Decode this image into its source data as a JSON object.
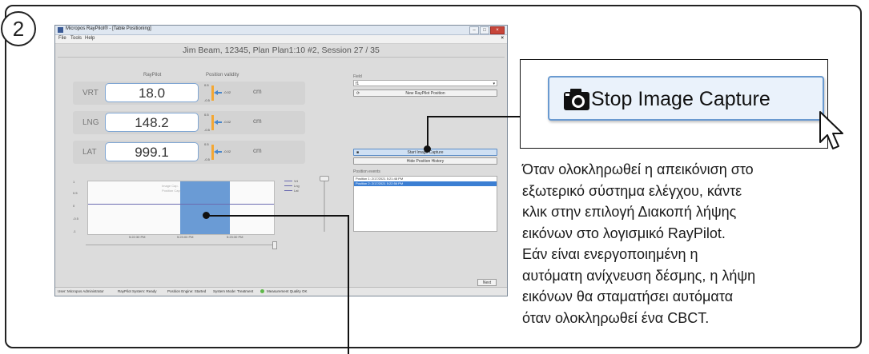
{
  "step_number": "2",
  "window": {
    "title": "Micropos RayPilot® - [Table Positioning]",
    "menu": [
      "File",
      "Tools",
      "Help"
    ],
    "menu_close": "×",
    "controls": {
      "minimize": "–",
      "maximize": "□",
      "close": "×"
    },
    "patient_info": "Jim Beam, 12345, Plan Plan1:10 #2, Session 27 / 35"
  },
  "position_panel": {
    "raypilot_header": "RayPilot",
    "validity_header": "Position validity",
    "rows": [
      {
        "axis": "VRT",
        "value": "18.0",
        "val_top": "0.5",
        "val_mid": "-0.02",
        "val_bot": "-0.5",
        "unit": "cm"
      },
      {
        "axis": "LNG",
        "value": "148.2",
        "val_top": "0.5",
        "val_mid": "-0.02",
        "val_bot": "-0.5",
        "unit": "cm"
      },
      {
        "axis": "LAT",
        "value": "999.1",
        "val_top": "0.5",
        "val_mid": "-0.02",
        "val_bot": "-0.5",
        "unit": "cm"
      }
    ]
  },
  "graph": {
    "y_ticks": [
      "1",
      "0.5",
      "0",
      "-0.5",
      "-1"
    ],
    "x_ticks": [
      "5:22:30 PM",
      "5:23:00 PM",
      "5:23:30 PM"
    ],
    "legend": [
      "Vrt",
      "Lng",
      "Lat"
    ],
    "region_labels": [
      "Image Cap.",
      "Position Cap."
    ]
  },
  "right_panel": {
    "field_label": "Field",
    "field_value": "f1",
    "new_position_button": "New RayPilot Position",
    "start_capture_button": "Start Image Capture",
    "hide_history_button": "Hide Position History",
    "events_label": "Position events",
    "events": [
      {
        "text": "Position 1: 2/17/2021 5:21:48 PM",
        "selected": false
      },
      {
        "text": "Position 2: 2/17/2021 5:22:56 PM",
        "selected": true
      }
    ],
    "next_button": "Next"
  },
  "statusbar": {
    "user": "User: Micropos Administrator",
    "system": "RayPilot System: Ready",
    "engine": "Position Engine: Started",
    "mode": "System Mode: Treatment",
    "quality": "Measurement Quality OK"
  },
  "callout": {
    "button_label": "Stop Image Capture",
    "button_icon": "camera-icon",
    "description_lines": [
      "Όταν ολοκληρωθεί η απεικόνιση στο",
      "εξωτερικό σύστημα ελέγχου, κάντε",
      "κλικ στην επιλογή Διακοπή λήψης",
      "εικόνων στο λογισμικό RayPilot.",
      "Εάν είναι ενεργοποιημένη η",
      "αυτόματη ανίχνευση δέσμης, η λήψη",
      "εικόνων θα σταματήσει αυτόματα",
      "όταν ολοκληρωθεί ένα CBCT."
    ]
  },
  "colors": {
    "accent_blue": "#6a9bd5",
    "validity_orange": "#f4a732",
    "event_selected": "#3c7fd3"
  }
}
